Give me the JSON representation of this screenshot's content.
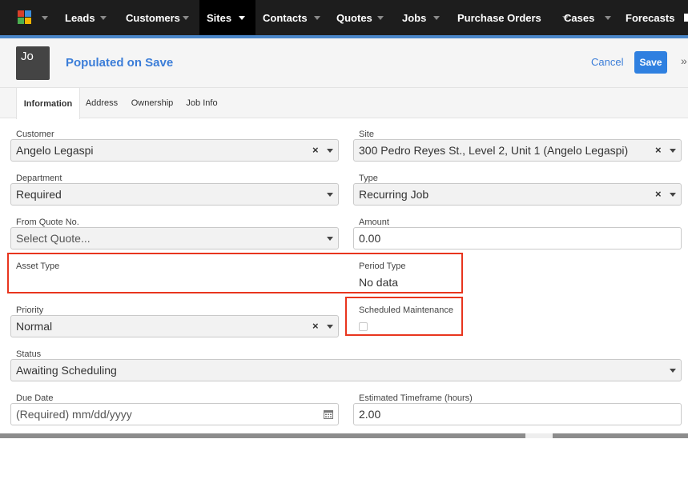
{
  "nav": {
    "items": [
      {
        "label": "Leads"
      },
      {
        "label": "Customers"
      },
      {
        "label": "Sites"
      },
      {
        "label": "Contacts"
      },
      {
        "label": "Quotes"
      },
      {
        "label": "Jobs"
      },
      {
        "label": "Purchase Orders"
      },
      {
        "label": "Cases"
      },
      {
        "label": "Forecasts"
      }
    ],
    "active": "Sites",
    "accent_color": "#4a86c8",
    "logo_colors": [
      "#d8402a",
      "#3e8fdb",
      "#4caf50",
      "#f4b400"
    ]
  },
  "header": {
    "avatar_text": "Jo",
    "title": "Populated on Save",
    "cancel_label": "Cancel",
    "save_label": "Save",
    "more_label": "»"
  },
  "tabs": [
    {
      "label": "Information",
      "active": true
    },
    {
      "label": "Address"
    },
    {
      "label": "Ownership"
    },
    {
      "label": "Job Info"
    }
  ],
  "form": {
    "customer": {
      "label": "Customer",
      "value": "Angelo Legaspi"
    },
    "site": {
      "label": "Site",
      "value": "300 Pedro Reyes St., Level 2, Unit 1 (Angelo Legaspi)"
    },
    "department": {
      "label": "Department",
      "value": "Required"
    },
    "type": {
      "label": "Type",
      "value": "Recurring Job"
    },
    "from_quote": {
      "label": "From Quote No.",
      "value": "Select Quote..."
    },
    "amount": {
      "label": "Amount",
      "value": "0.00"
    },
    "asset_type": {
      "label": "Asset Type"
    },
    "period_type": {
      "label": "Period Type",
      "value": "No data"
    },
    "priority": {
      "label": "Priority",
      "value": "Normal"
    },
    "scheduled_maintenance": {
      "label": "Scheduled Maintenance",
      "checked": false
    },
    "status": {
      "label": "Status",
      "value": "Awaiting Scheduling"
    },
    "due_date": {
      "label": "Due Date",
      "placeholder": "(Required) mm/dd/yyyy"
    },
    "estimated_timeframe": {
      "label": "Estimated Timeframe (hours)",
      "value": "2.00"
    }
  },
  "highlight_color": "#e8351e",
  "clear_icon": "×"
}
